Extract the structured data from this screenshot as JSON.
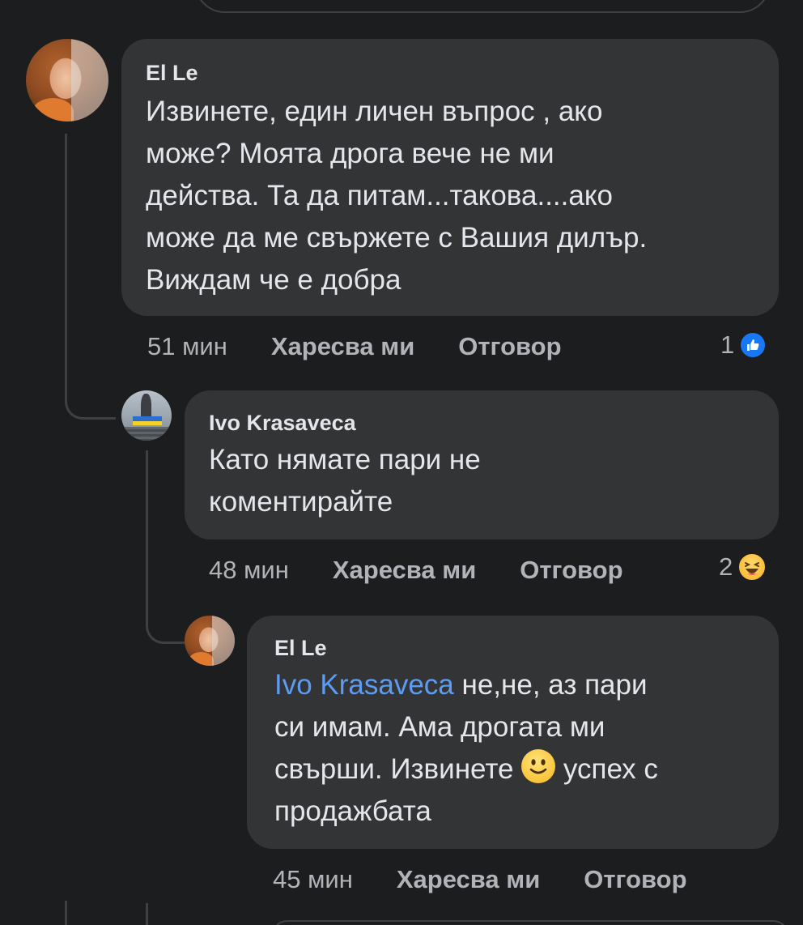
{
  "comments": [
    {
      "author": "El Le",
      "text": "Извинете, един личен въпрос , ако може? Моята дрога вече не ми действа. Та да питам...такова....ако може да ме свържете с Вашия дилър. Виждам че е добра",
      "lines": [
        "Извинете, един личен въпрос , ако",
        "може? Моята дрога вече не ми",
        "действа. Та да питам...такова....ако",
        "може да ме свържете с Вашия дилър.",
        "Виждам че е добра"
      ],
      "time": "51 мин",
      "like_label": "Харесва ми",
      "reply_label": "Отговор",
      "reaction_count": "1",
      "reaction_icon": "like-icon"
    },
    {
      "author": "Ivo Krasaveca",
      "lines": [
        "Като нямате пари не",
        "коментирайте"
      ],
      "time": "48 мин",
      "like_label": "Харесва ми",
      "reply_label": "Отговор",
      "reaction_count": "2",
      "reaction_icon": "haha-icon"
    },
    {
      "author": "El Le",
      "mention": "Ivo Krasaveca",
      "line1_rest": " не,не, аз пари",
      "line2": "си имам. Ама дрогата ми",
      "line3_before": "свърши. Извинете ",
      "line3_after": " успех с",
      "line4": "продажбата",
      "emoji": "slightly-smiling-face-icon",
      "time": "45 мин",
      "like_label": "Харесва ми",
      "reply_label": "Отговор"
    }
  ],
  "colors": {
    "background": "#1c1d1f",
    "bubble": "#333436",
    "mention": "#5e9bf2",
    "like_blue": "#1877f2",
    "secondary_text": "#b0b3b8"
  }
}
